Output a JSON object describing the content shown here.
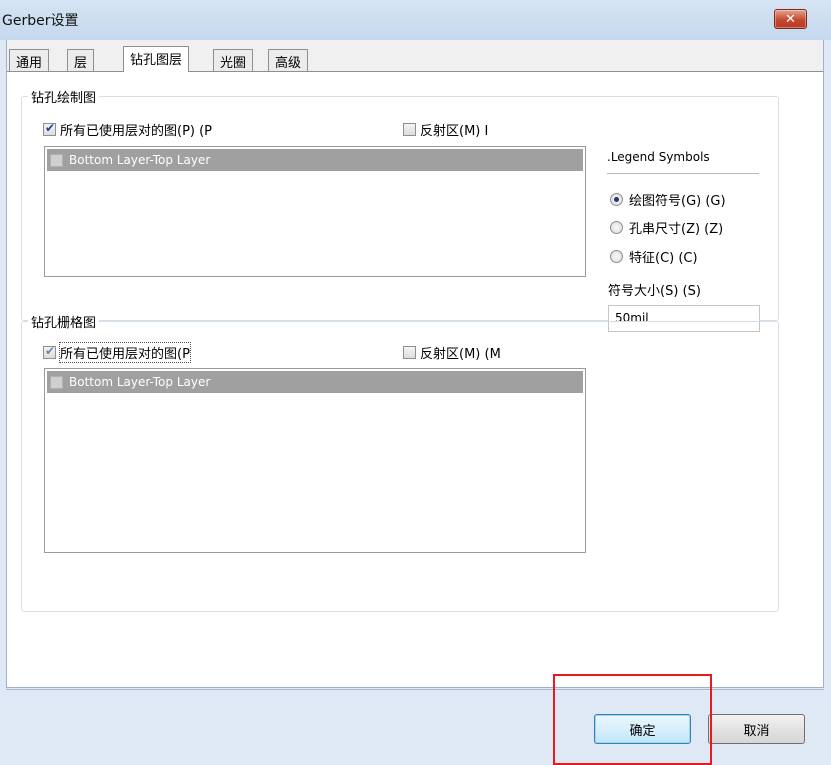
{
  "window": {
    "title": "Gerber设置",
    "close_label": "✕"
  },
  "tabs": [
    {
      "label": "通用",
      "active": false
    },
    {
      "label": "层",
      "active": false
    },
    {
      "label": "钻孔图层",
      "active": true
    },
    {
      "label": "光圈",
      "active": false
    },
    {
      "label": "高级",
      "active": false
    }
  ],
  "drill_drawing": {
    "label": "钻孔绘制图",
    "all_layers_label": "所有已使用层对的图(P) (P",
    "all_layers_checked": true,
    "mirror_label": "反射区(M) I",
    "mirror_checked": false,
    "layer_pairs": [
      {
        "label": "Bottom Layer-Top Layer",
        "checked": false
      }
    ]
  },
  "legend": {
    "title": ".Legend Symbols",
    "options": [
      {
        "label": "绘图符号(G) (G)",
        "selected": true
      },
      {
        "label": "孔串尺寸(Z) (Z)",
        "selected": false
      },
      {
        "label": "特征(C) (C)",
        "selected": false
      }
    ],
    "symbol_size_label": "符号大小(S) (S)",
    "symbol_size_value": "50mil"
  },
  "drill_guide": {
    "label": "钻孔栅格图",
    "all_layers_label": "所有已使用层对的图(P",
    "all_layers_checked": true,
    "mirror_label": "反射区(M) (M",
    "mirror_checked": false,
    "layer_pairs": [
      {
        "label": "Bottom Layer-Top Layer",
        "checked": false
      }
    ]
  },
  "buttons": {
    "ok_label": "确定",
    "cancel_label": "取消"
  },
  "colors": {
    "highlight": "#e8191f",
    "selected_row": "#a0a0a0"
  }
}
